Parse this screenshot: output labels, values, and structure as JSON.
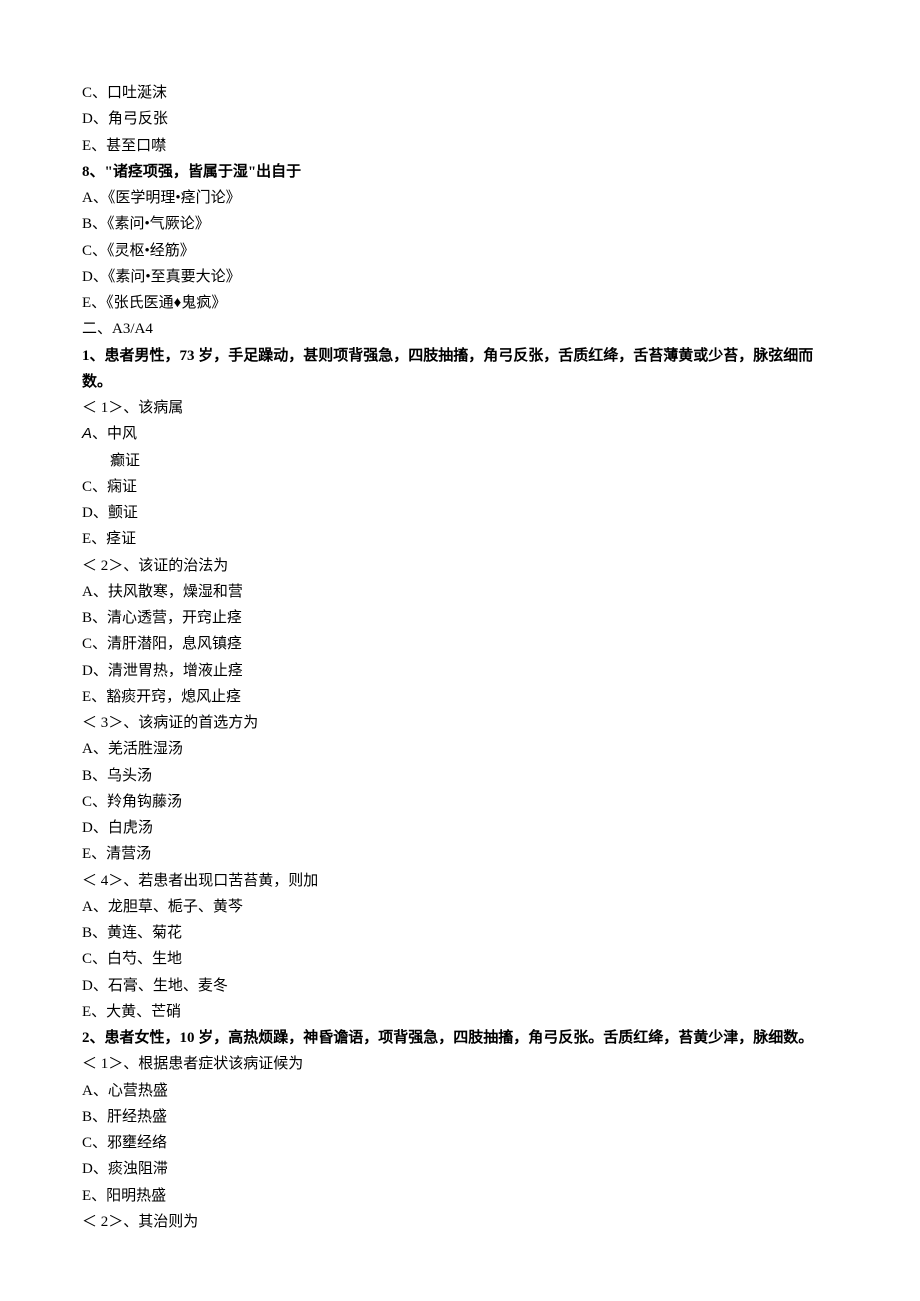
{
  "q7_options": {
    "C": "C、口吐涎沫",
    "D": "D、角弓反张",
    "E": "E、甚至口噤"
  },
  "q8": {
    "stem": "8、\"诸痉项强，皆属于湿\"出自于",
    "A": "A、《医学明理•痉门论》",
    "B": "B、《素问•气厥论》",
    "C": "C、《灵枢•经筋》",
    "D": "D、《素问•至真要大论》",
    "E": "E、《张氏医通♦鬼疯》"
  },
  "section2": "二、A3/A4",
  "case1": {
    "stem": "1、患者男性，73 岁，手足躁动，甚则项背强急，四肢抽搐，角弓反张，舌质红绛，舌苔薄黄或少苔，脉弦细而数。",
    "sub1": {
      "label": "＜ 1＞、该病属",
      "A_letter": "A",
      "A_text": "、中风",
      "B": "癫证",
      "C": "C、痫证",
      "D": "D、颤证",
      "E": "E、痉证"
    },
    "sub2": {
      "label": "＜ 2＞、该证的治法为",
      "A": "A、扶风散寒，燥湿和营",
      "B": "B、清心透营，开窍止痉",
      "C": "C、清肝潜阳，息风镇痉",
      "D": "D、清泄胃热，增液止痉",
      "E": "E、豁痰开窍，熄风止痉"
    },
    "sub3": {
      "label": "＜ 3＞、该病证的首选方为",
      "A": "A、羌活胜湿汤",
      "B": "B、乌头汤",
      "C": "C、羚角钩藤汤",
      "D": "D、白虎汤",
      "E": "E、清营汤"
    },
    "sub4": {
      "label": "＜ 4＞、若患者出现口苦苔黄，则加",
      "A": "A、龙胆草、栀子、黄芩",
      "B": "B、黄连、菊花",
      "C": "C、白芍、生地",
      "D": "D、石膏、生地、麦冬",
      "E": "E、大黄、芒硝"
    }
  },
  "case2": {
    "stem": "2、患者女性，10 岁，高热烦躁，神昏谵语，项背强急，四肢抽搐，角弓反张。舌质红绛，苔黄少津，脉细数。",
    "sub1": {
      "label": "＜ 1＞、根据患者症状该病证候为",
      "A": "A、心营热盛",
      "B": "B、肝经热盛",
      "C": "C、邪壅经络",
      "D": "D、痰浊阻滞",
      "E": "E、阳明热盛"
    },
    "sub2": {
      "label": "＜ 2＞、其治则为"
    }
  }
}
